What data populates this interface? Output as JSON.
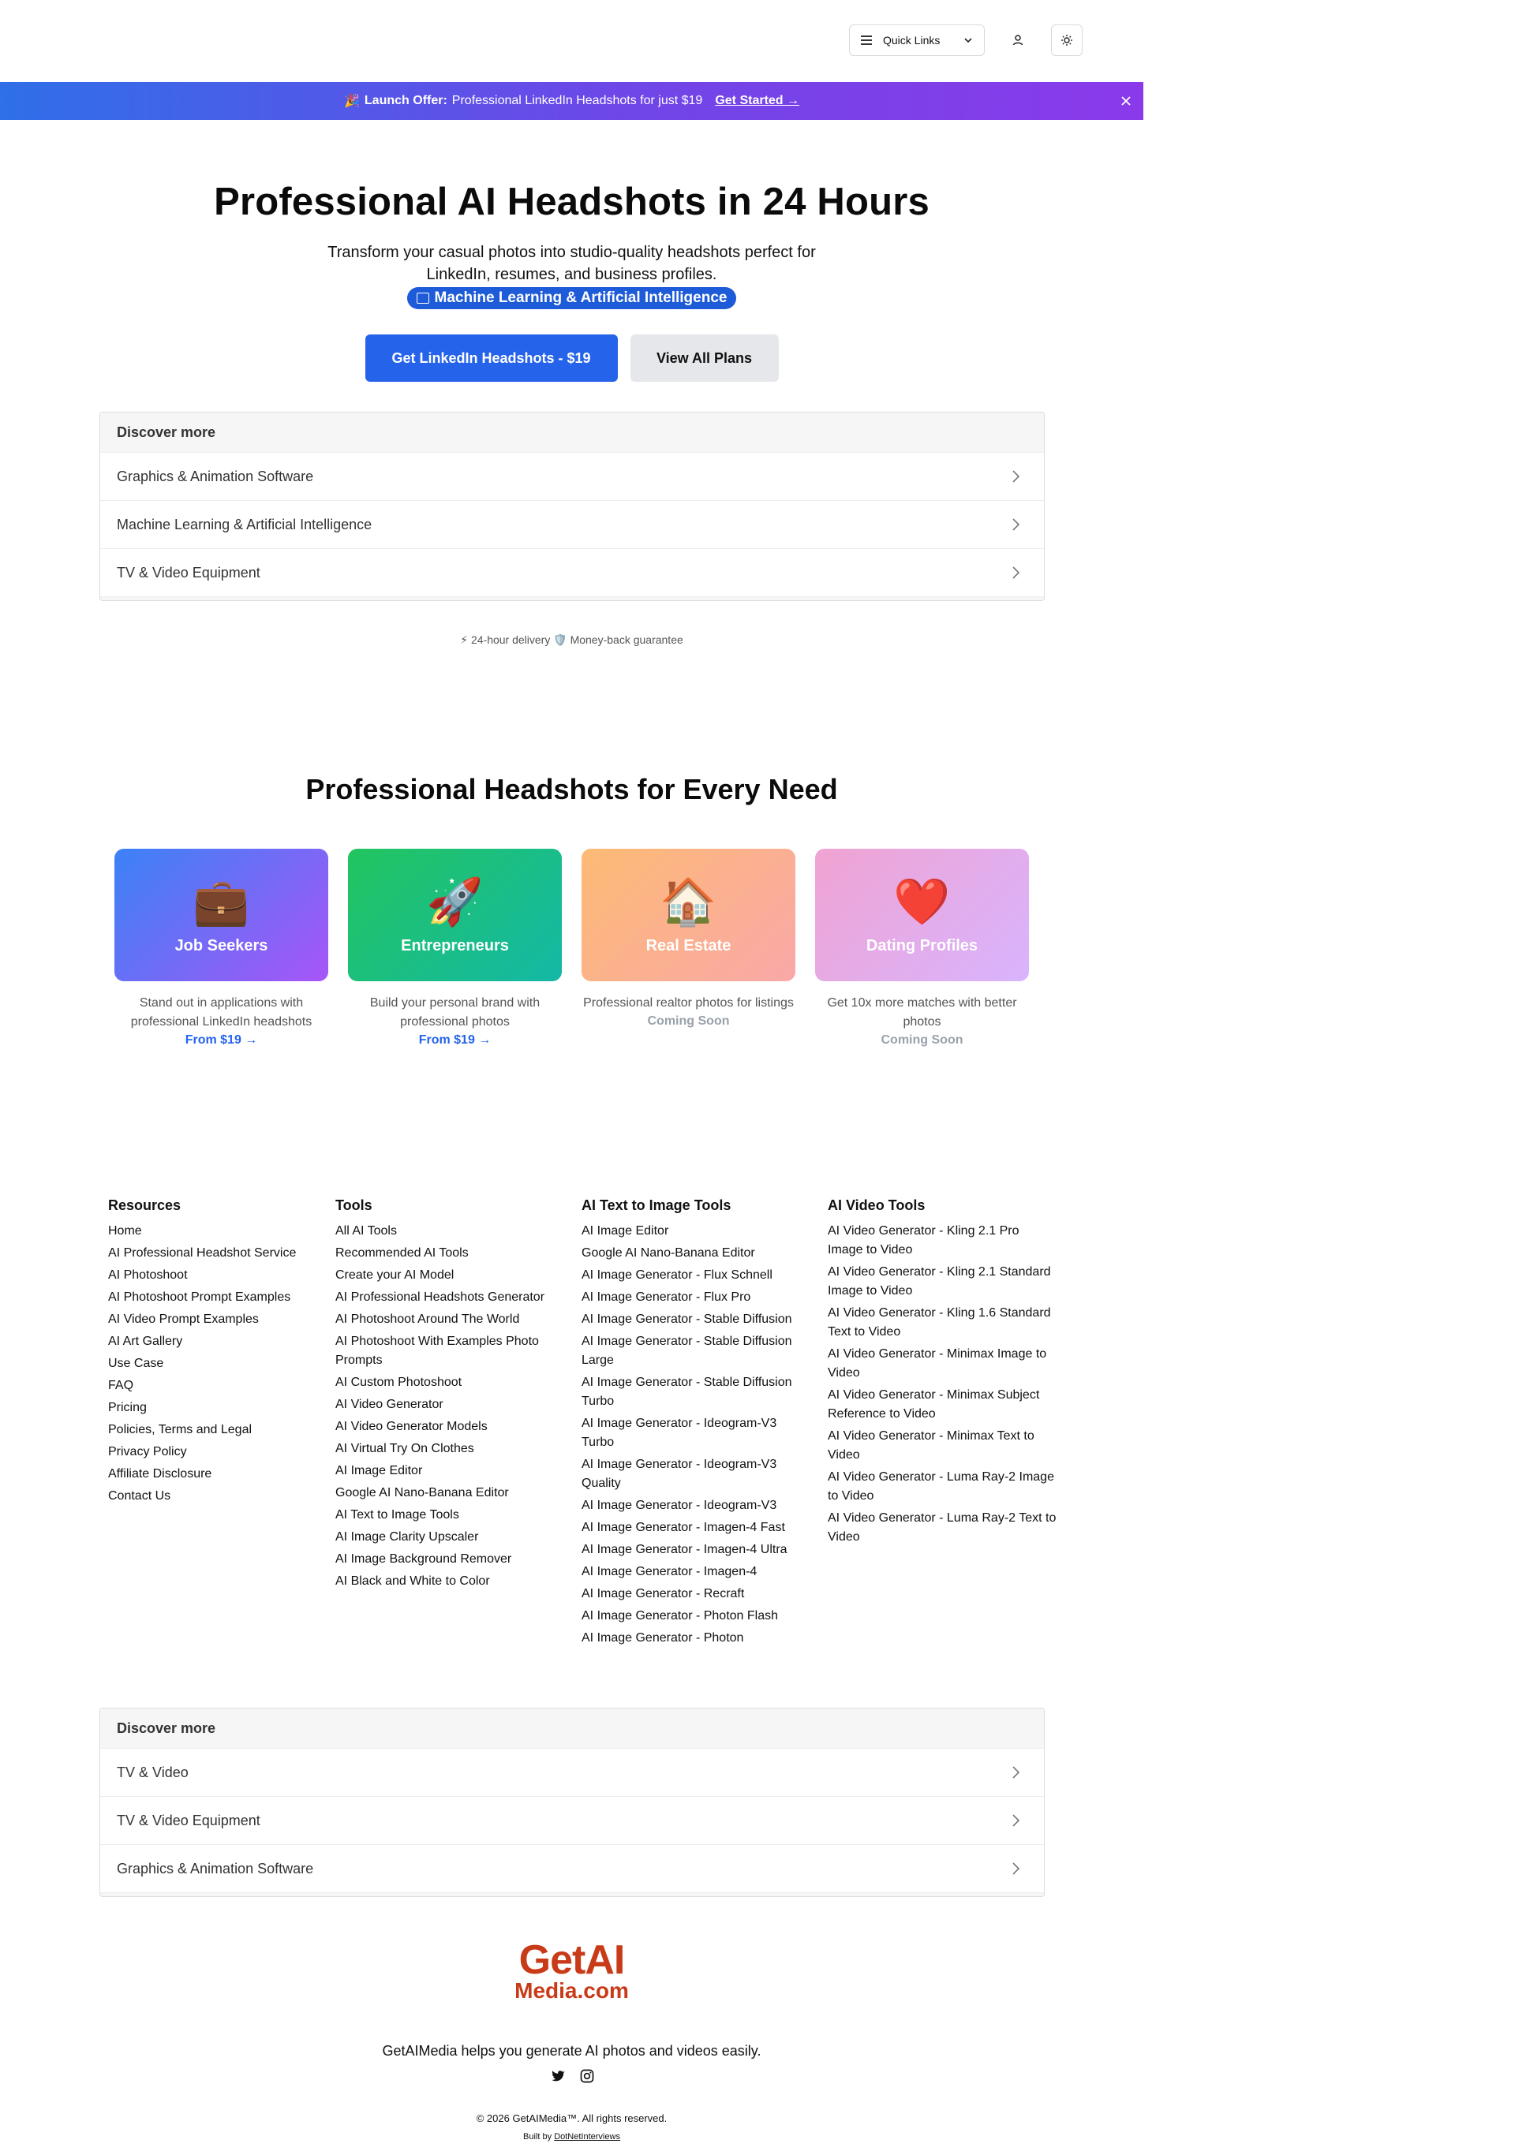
{
  "topbar": {
    "quick_links_label": "Quick Links",
    "icons": [
      "menu-icon",
      "chevron-down-icon",
      "user-icon",
      "sun-icon"
    ]
  },
  "banner": {
    "emoji": "🎉",
    "title": "Launch Offer:",
    "text": "Professional LinkedIn Headshots for just $19",
    "cta": "Get Started →",
    "gradient": [
      "#2f6fe8",
      "#8a3aea"
    ]
  },
  "hero": {
    "title": "Professional AI Headshots in 24 Hours",
    "subtitle": "Transform your casual photos into studio-quality headshots perfect for LinkedIn, resumes, and business profiles.",
    "pill": "Machine Learning & Artificial Intelligence",
    "primary_cta": "Get LinkedIn Headshots - $19",
    "secondary_cta": "View All Plans"
  },
  "discover_top": {
    "title": "Discover more",
    "items": [
      "Graphics & Animation Software",
      "Machine Learning & Artificial Intelligence",
      "TV & Video Equipment"
    ]
  },
  "badges": {
    "delivery_emoji": "⚡",
    "delivery": "24-hour delivery",
    "guarantee_emoji": "🛡️",
    "guarantee": "Money-back guarantee"
  },
  "needs": {
    "title": "Professional Headshots for Every Need",
    "cards": [
      {
        "emoji": "💼",
        "title": "Job Seekers",
        "desc": "Stand out in applications with professional LinkedIn headshots",
        "link": "From $19 →"
      },
      {
        "emoji": "🚀",
        "title": "Entrepreneurs",
        "desc": "Build your personal brand with professional photos",
        "link": "From $19 →"
      },
      {
        "emoji": "🏠",
        "title": "Real Estate",
        "desc": "Professional realtor photos for listings",
        "soon": "Coming Soon"
      },
      {
        "emoji": "❤️",
        "title": "Dating Profiles",
        "desc": "Get 10x more matches with better photos",
        "soon": "Coming Soon"
      }
    ]
  },
  "footer": {
    "resources": {
      "title": "Resources",
      "items": [
        "Home",
        "AI Professional Headshot Service",
        "AI Photoshoot",
        "AI Photoshoot Prompt Examples",
        "AI Video Prompt Examples",
        "AI Art Gallery",
        "Use Case",
        "FAQ",
        "Pricing",
        "Policies, Terms and Legal",
        "Privacy Policy",
        "Affiliate Disclosure",
        "Contact Us"
      ]
    },
    "tools": {
      "title": "Tools",
      "items": [
        "All AI Tools",
        "Recommended AI Tools",
        "Create your AI Model",
        "AI Professional Headshots Generator",
        "AI Photoshoot Around The World",
        "AI Photoshoot With Examples Photo Prompts",
        "AI Custom Photoshoot",
        "AI Video Generator",
        "AI Video Generator Models",
        "AI Virtual Try On Clothes",
        "AI Image Editor",
        "Google AI Nano-Banana Editor",
        "AI Text to Image Tools",
        "AI Image Clarity Upscaler",
        "AI Image Background Remover",
        "AI Black and White to Color"
      ]
    },
    "text_to_image": {
      "title": "AI Text to Image Tools",
      "items": [
        "AI Image Editor",
        "Google AI Nano-Banana Editor",
        "AI Image Generator - Flux Schnell",
        "AI Image Generator - Flux Pro",
        "AI Image Generator - Stable Diffusion",
        "AI Image Generator - Stable Diffusion Large",
        "AI Image Generator - Stable Diffusion Turbo",
        "AI Image Generator - Ideogram-V3 Turbo",
        "AI Image Generator - Ideogram-V3 Quality",
        "AI Image Generator - Ideogram-V3",
        "AI Image Generator - Imagen-4 Fast",
        "AI Image Generator - Imagen-4 Ultra",
        "AI Image Generator - Imagen-4",
        "AI Image Generator - Recraft",
        "AI Image Generator - Photon Flash",
        "AI Image Generator - Photon"
      ]
    },
    "video_tools": {
      "title": "AI Video Tools",
      "items": [
        "AI Video Generator - Kling 2.1 Pro Image to Video",
        "AI Video Generator - Kling 2.1 Standard Image to Video",
        "AI Video Generator - Kling 1.6 Standard Text to Video",
        "AI Video Generator - Minimax Image to Video",
        "AI Video Generator - Minimax Subject Reference to Video",
        "AI Video Generator - Minimax Text to Video",
        "AI Video Generator - Luma Ray-2 Image to Video",
        "AI Video Generator - Luma Ray-2 Text to Video"
      ]
    }
  },
  "discover_bottom": {
    "title": "Discover more",
    "items": [
      "TV & Video",
      "TV & Video Equipment",
      "Graphics & Animation Software"
    ]
  },
  "brand": {
    "logo_line1": "GetAI",
    "logo_line2": "Media.com",
    "logo_color": "#c83a18",
    "tagline": "GetAIMedia helps you generate AI photos and videos easily.",
    "social_icons": [
      "twitter-icon",
      "instagram-icon"
    ],
    "copyright": "© 2026 GetAIMedia™. All rights reserved.",
    "built_by_prefix": "Built by",
    "built_by_link": "DotNetInterviews"
  }
}
